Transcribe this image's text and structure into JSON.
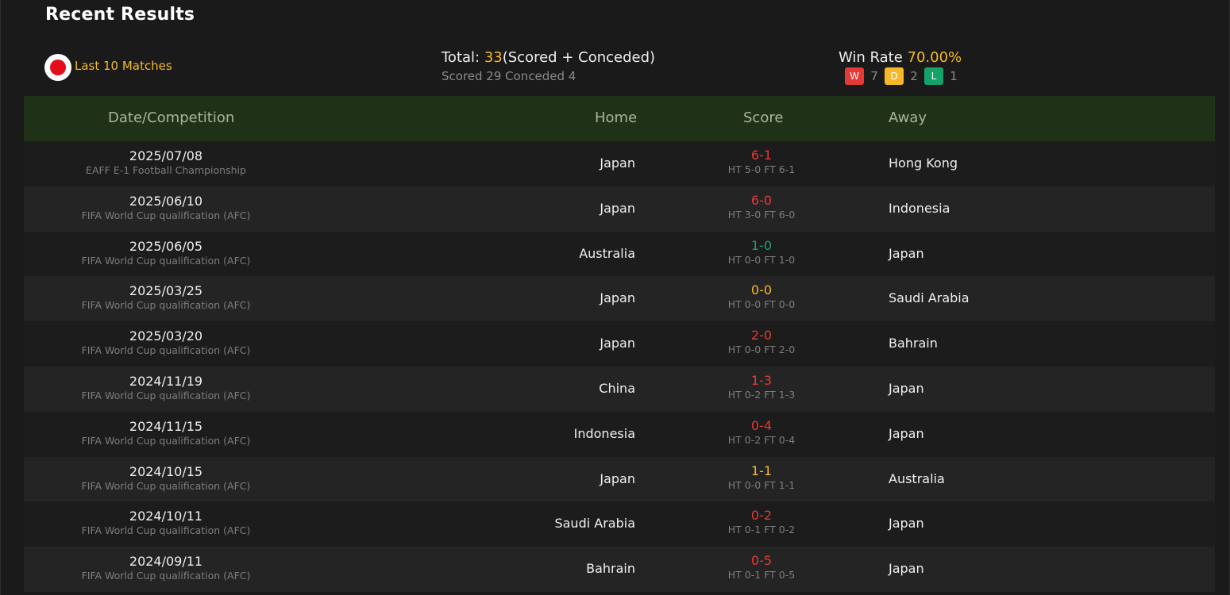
{
  "section_title": "Recent Results",
  "filter_label": "Last 10 Matches",
  "summary": {
    "total_label": "Total: ",
    "total_value": "33",
    "total_suffix": "(Scored + Conceded)",
    "scored_conceded": "Scored 29 Conceded 4",
    "win_rate_label": "Win Rate ",
    "win_rate_value": "70.00%",
    "w_label": "W",
    "w_count": "7",
    "d_label": "D",
    "d_count": "2",
    "l_label": "L",
    "l_count": "1"
  },
  "colors": {
    "win": "#e53935",
    "draw": "#f5b928",
    "loss": "#16a36a",
    "header_bg": "#1f3217"
  },
  "table": {
    "headers": {
      "date": "Date/Competition",
      "home": "Home",
      "score": "Score",
      "away": "Away"
    },
    "rows": [
      {
        "date": "2025/07/08",
        "competition": "EAFF E-1 Football Championship",
        "home": "Japan",
        "score": "6-1",
        "result": "win",
        "ht_ft": "HT 5-0 FT 6-1",
        "away": "Hong Kong"
      },
      {
        "date": "2025/06/10",
        "competition": "FIFA World Cup qualification (AFC)",
        "home": "Japan",
        "score": "6-0",
        "result": "win",
        "ht_ft": "HT 3-0 FT 6-0",
        "away": "Indonesia"
      },
      {
        "date": "2025/06/05",
        "competition": "FIFA World Cup qualification (AFC)",
        "home": "Australia",
        "score": "1-0",
        "result": "loss",
        "ht_ft": "HT 0-0 FT 1-0",
        "away": "Japan"
      },
      {
        "date": "2025/03/25",
        "competition": "FIFA World Cup qualification (AFC)",
        "home": "Japan",
        "score": "0-0",
        "result": "draw",
        "ht_ft": "HT 0-0 FT 0-0",
        "away": "Saudi Arabia"
      },
      {
        "date": "2025/03/20",
        "competition": "FIFA World Cup qualification (AFC)",
        "home": "Japan",
        "score": "2-0",
        "result": "win",
        "ht_ft": "HT 0-0 FT 2-0",
        "away": "Bahrain"
      },
      {
        "date": "2024/11/19",
        "competition": "FIFA World Cup qualification (AFC)",
        "home": "China",
        "score": "1-3",
        "result": "win",
        "ht_ft": "HT 0-2 FT 1-3",
        "away": "Japan"
      },
      {
        "date": "2024/11/15",
        "competition": "FIFA World Cup qualification (AFC)",
        "home": "Indonesia",
        "score": "0-4",
        "result": "win",
        "ht_ft": "HT 0-2 FT 0-4",
        "away": "Japan"
      },
      {
        "date": "2024/10/15",
        "competition": "FIFA World Cup qualification (AFC)",
        "home": "Japan",
        "score": "1-1",
        "result": "draw",
        "ht_ft": "HT 0-0 FT 1-1",
        "away": "Australia"
      },
      {
        "date": "2024/10/11",
        "competition": "FIFA World Cup qualification (AFC)",
        "home": "Saudi Arabia",
        "score": "0-2",
        "result": "win",
        "ht_ft": "HT 0-1 FT 0-2",
        "away": "Japan"
      },
      {
        "date": "2024/09/11",
        "competition": "FIFA World Cup qualification (AFC)",
        "home": "Bahrain",
        "score": "0-5",
        "result": "win",
        "ht_ft": "HT 0-1 FT 0-5",
        "away": "Japan"
      }
    ]
  }
}
